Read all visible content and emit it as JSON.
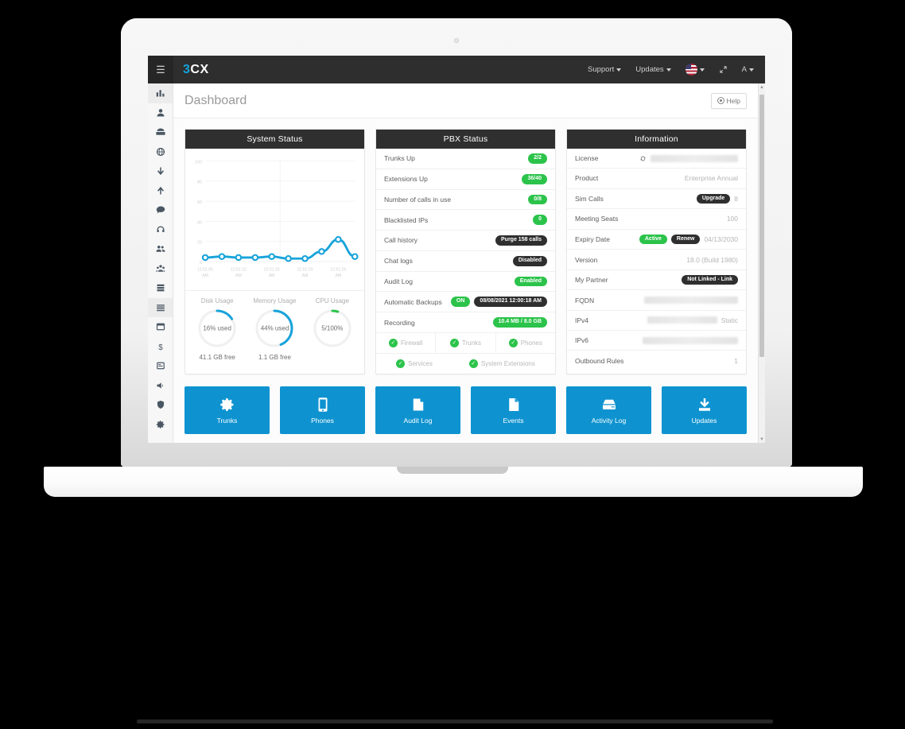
{
  "navbar": {
    "burger_icon": "hamburger-icon",
    "logo_prefix": "3",
    "logo_suffix": "CX",
    "support_label": "Support",
    "updates_label": "Updates",
    "language_icon": "us-flag-icon",
    "expand_icon": "expand-arrows-icon",
    "account_label": "A"
  },
  "sidebar": {
    "items": [
      {
        "name": "dashboard",
        "icon": "bar-chart-icon",
        "active": true
      },
      {
        "name": "users",
        "icon": "user-icon",
        "active": false
      },
      {
        "name": "phones",
        "icon": "desk-phone-icon",
        "active": false
      },
      {
        "name": "sip-trunks",
        "icon": "globe-icon",
        "active": false
      },
      {
        "name": "inbound-rules",
        "icon": "arrow-down-icon",
        "active": false
      },
      {
        "name": "outbound-rules",
        "icon": "arrow-up-icon",
        "active": false
      },
      {
        "name": "chat",
        "icon": "chat-bubble-icon",
        "active": false
      },
      {
        "name": "call-center",
        "icon": "headset-icon",
        "active": false
      },
      {
        "name": "contacts",
        "icon": "people-icon",
        "active": false
      },
      {
        "name": "groups",
        "icon": "group-icon",
        "active": false
      },
      {
        "name": "backup-restore",
        "icon": "server-icon",
        "active": false
      },
      {
        "name": "activity-log",
        "icon": "list-icon",
        "active": true
      },
      {
        "name": "reports",
        "icon": "window-icon",
        "active": false
      },
      {
        "name": "billing",
        "icon": "dollar-icon",
        "active": false
      },
      {
        "name": "settings-panel",
        "icon": "panel-icon",
        "active": false
      },
      {
        "name": "announcements",
        "icon": "megaphone-icon",
        "active": false
      },
      {
        "name": "security",
        "icon": "shield-icon",
        "active": false
      },
      {
        "name": "settings",
        "icon": "gear-icon",
        "active": false
      }
    ]
  },
  "page": {
    "title": "Dashboard",
    "help_label": "Help",
    "help_icon": "help-circle-icon"
  },
  "system_status": {
    "title": "System Status",
    "gauges": [
      {
        "title": "Disk Usage",
        "value": "16% used",
        "sub": "41.1 GB free",
        "percent": 16,
        "color": "#17a3da"
      },
      {
        "title": "Memory Usage",
        "value": "44% used",
        "sub": "1.1 GB free",
        "percent": 44,
        "color": "#17a3da"
      },
      {
        "title": "CPU Usage",
        "value": "5/100%",
        "sub": "",
        "percent": 5,
        "color": "#2bc34a"
      }
    ]
  },
  "chart_data": {
    "type": "line",
    "title": "System Status",
    "xlabel": "",
    "ylabel": "",
    "ylim": [
      0,
      100
    ],
    "yticks": [
      0,
      20,
      40,
      60,
      80,
      100
    ],
    "grid": true,
    "legend": false,
    "x": [
      "11:51:05 AM",
      "",
      "12:51:10 AM",
      "",
      "12:51:15 AM",
      "",
      "11:51:20 AM",
      "",
      "12:51:25 AM",
      ""
    ],
    "xtick_labels": [
      "11:51:05 AM",
      "12:51:10 AM",
      "12:51:15 AM",
      "11:51:20 AM",
      "12:51:25 AM"
    ],
    "series": [
      {
        "name": "CPU Usage",
        "color": "#17a3da",
        "values": [
          4,
          5,
          4,
          4,
          5,
          3,
          3,
          10,
          22,
          5
        ]
      }
    ]
  },
  "pbx_status": {
    "title": "PBX Status",
    "rows": [
      {
        "label": "Trunks Up",
        "badge": "2/2",
        "badge_style": "green"
      },
      {
        "label": "Extensions Up",
        "badge": "36/40",
        "badge_style": "green"
      },
      {
        "label": "Number of calls in use",
        "badge": "0/8",
        "badge_style": "green"
      },
      {
        "label": "Blacklisted IPs",
        "badge": "0",
        "badge_style": "green"
      },
      {
        "label": "Call history",
        "badge": "Purge 158 calls",
        "badge_style": "dark"
      },
      {
        "label": "Chat logs",
        "badge": "Disabled",
        "badge_style": "dark"
      },
      {
        "label": "Audit Log",
        "badge": "Enabled",
        "badge_style": "green"
      },
      {
        "label": "Automatic Backups",
        "badge": "ON",
        "badge_style": "green",
        "badge2": "08/08/2021 12:00:18 AM",
        "badge2_style": "dark"
      },
      {
        "label": "Recording",
        "badge": "10.4 MB / 8.0 GB",
        "badge_style": "green"
      }
    ],
    "checks_row1": [
      "Firewall",
      "Trunks",
      "Phones"
    ],
    "checks_row2": [
      "Services",
      "System Extensions"
    ],
    "check_icon": "checkmark-icon"
  },
  "information": {
    "title": "Information",
    "rows": [
      {
        "label": "License",
        "type": "blurred",
        "icon": "refresh-icon",
        "blur_width": 110
      },
      {
        "label": "Product",
        "type": "text",
        "value": "Enterprise Annual"
      },
      {
        "label": "Sim Calls",
        "type": "badge-text",
        "badge": "Upgrade",
        "badge_style": "dark",
        "value": "8"
      },
      {
        "label": "Meeting Seats",
        "type": "text",
        "value": "100"
      },
      {
        "label": "Expiry Date",
        "type": "two-badge-text",
        "badge": "Active",
        "badge_style": "green",
        "badge2": "Renew",
        "badge2_style": "dark",
        "value": "04/13/2030"
      },
      {
        "label": "Version",
        "type": "text",
        "value": "18.0 (Build 1980)"
      },
      {
        "label": "My Partner",
        "type": "badge",
        "badge": "Not Linked - Link",
        "badge_style": "dark"
      },
      {
        "label": "FQDN",
        "type": "blurred",
        "blur_width": 118
      },
      {
        "label": "IPv4",
        "type": "blurred-text",
        "blur_width": 88,
        "value": "Static"
      },
      {
        "label": "IPv6",
        "type": "blurred",
        "blur_width": 120
      },
      {
        "label": "Outbound Rules",
        "type": "text",
        "value": "1"
      }
    ]
  },
  "tiles": [
    {
      "label": "Trunks",
      "icon": "gear-icon"
    },
    {
      "label": "Phones",
      "icon": "mobile-phone-icon"
    },
    {
      "label": "Audit Log",
      "icon": "book-icon"
    },
    {
      "label": "Events",
      "icon": "document-icon"
    },
    {
      "label": "Activity Log",
      "icon": "hard-drive-icon"
    },
    {
      "label": "Updates",
      "icon": "download-icon"
    }
  ],
  "colors": {
    "accent": "#0e93d0",
    "chart_line": "#17a3da",
    "green": "#2bc34a",
    "dark": "#2f2f2f"
  }
}
